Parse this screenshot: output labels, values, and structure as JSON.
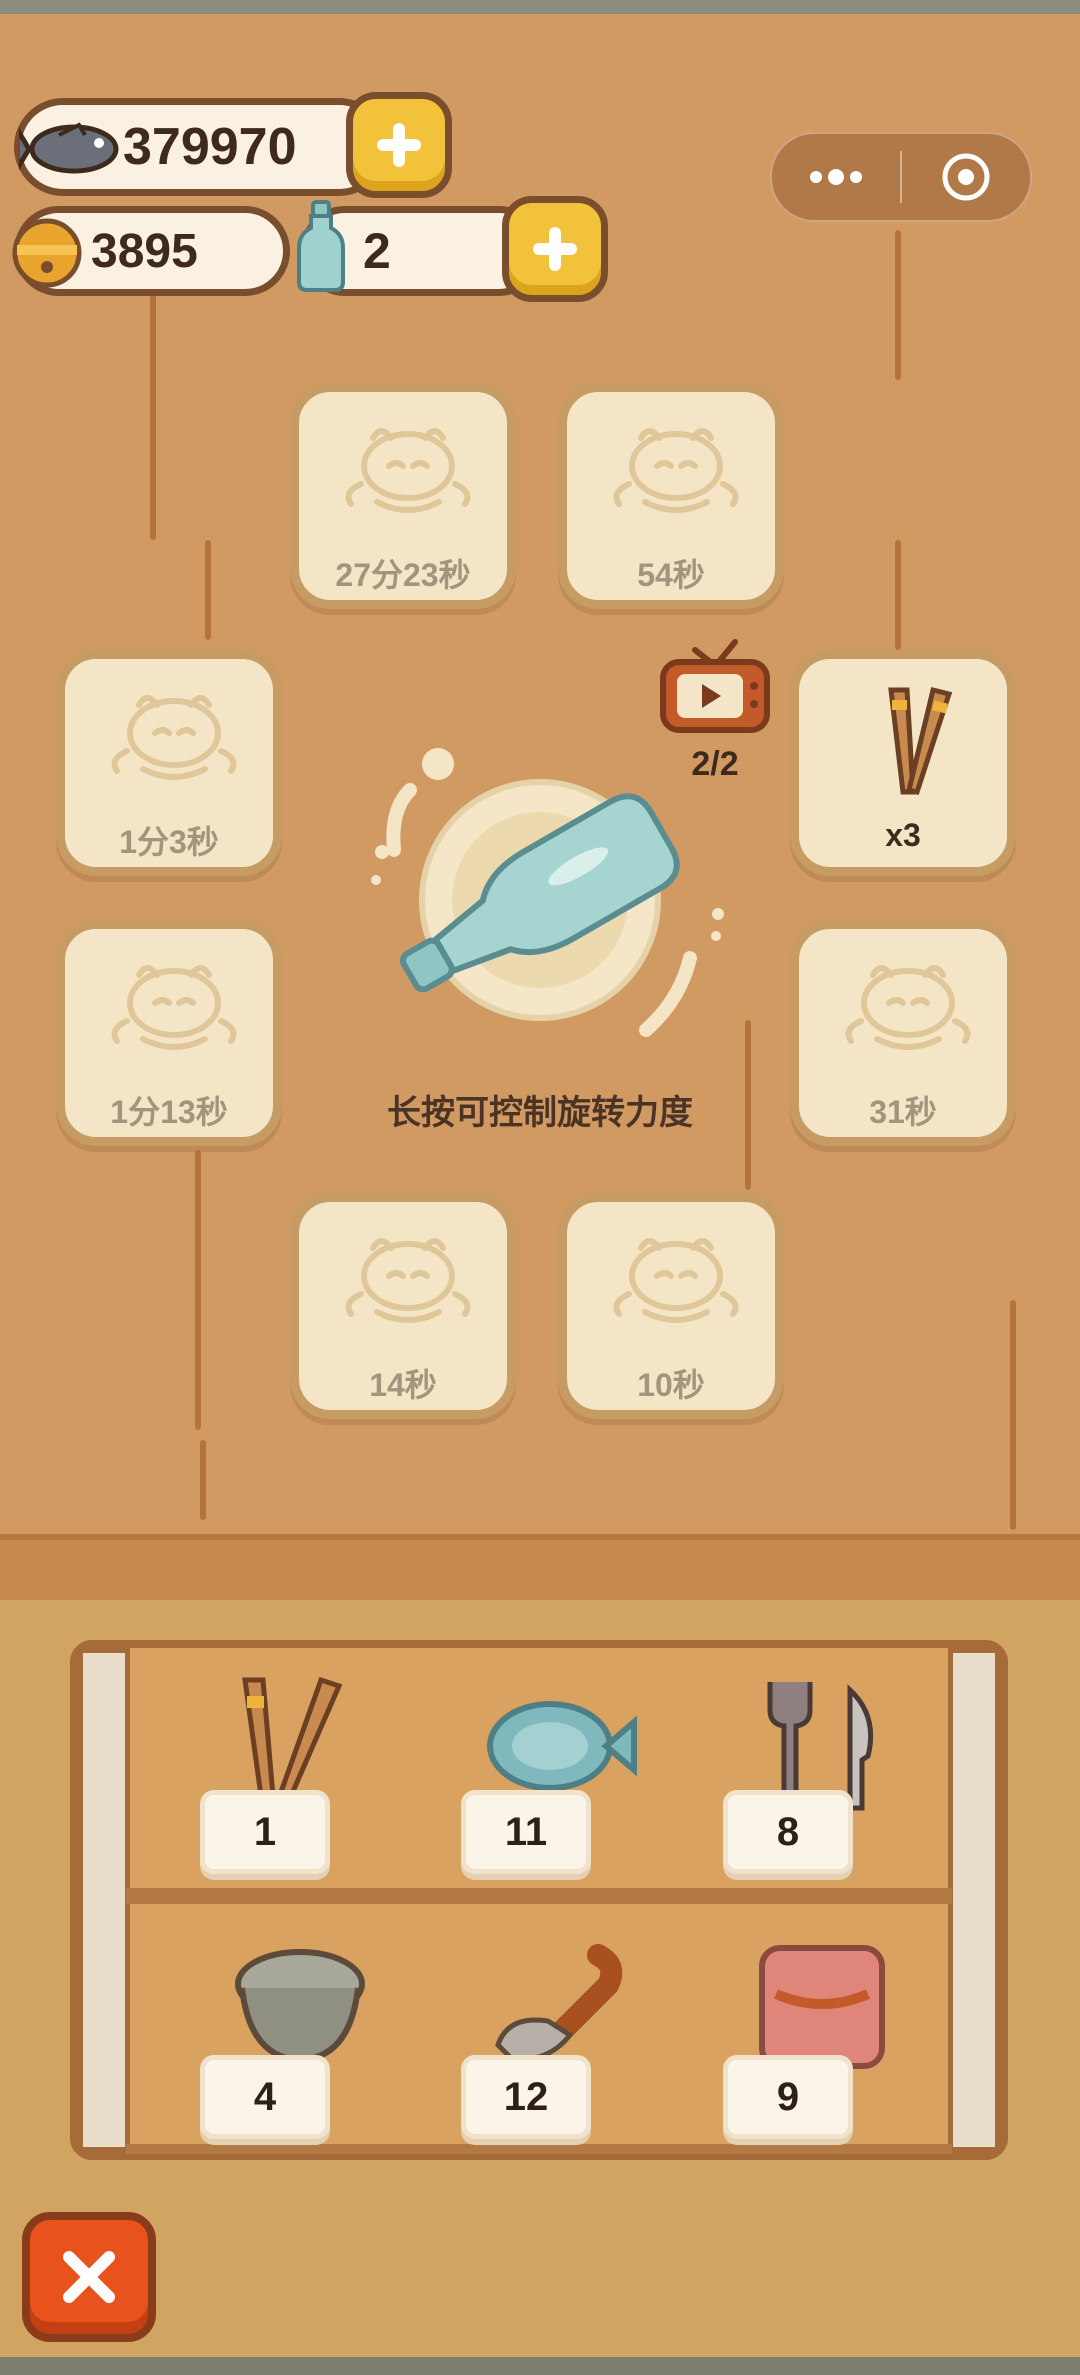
{
  "currency": {
    "fish": {
      "value": "379970",
      "icon": "fish-icon"
    },
    "bell": {
      "value": "3895",
      "icon": "bell-coin-icon"
    },
    "bottle": {
      "value": "2",
      "icon": "bottle-icon"
    }
  },
  "slots": [
    {
      "id": "top-left",
      "label": "27分23秒",
      "state": "locked"
    },
    {
      "id": "top-right",
      "label": "54秒",
      "state": "locked"
    },
    {
      "id": "mid-left-1",
      "label": "1分3秒",
      "state": "locked"
    },
    {
      "id": "mid-right-1",
      "label": "x3",
      "state": "reward",
      "item": "chopsticks"
    },
    {
      "id": "mid-left-2",
      "label": "1分13秒",
      "state": "locked"
    },
    {
      "id": "mid-right-2",
      "label": "31秒",
      "state": "locked"
    },
    {
      "id": "bottom-left",
      "label": "14秒",
      "state": "locked"
    },
    {
      "id": "bottom-right",
      "label": "10秒",
      "state": "locked"
    }
  ],
  "ad": {
    "count": "2/2"
  },
  "spin": {
    "hint": "长按可控制旋转力度"
  },
  "shelf": {
    "items": [
      {
        "name": "chopsticks",
        "count": "1"
      },
      {
        "name": "fish-plate",
        "count": "11"
      },
      {
        "name": "fork-knife",
        "count": "8"
      },
      {
        "name": "bowl",
        "count": "4"
      },
      {
        "name": "ladle",
        "count": "12"
      },
      {
        "name": "pot",
        "count": "9"
      }
    ]
  },
  "colors": {
    "accent": "#f2c23b",
    "close": "#e8531d",
    "bottle": "#8fc5c2"
  }
}
